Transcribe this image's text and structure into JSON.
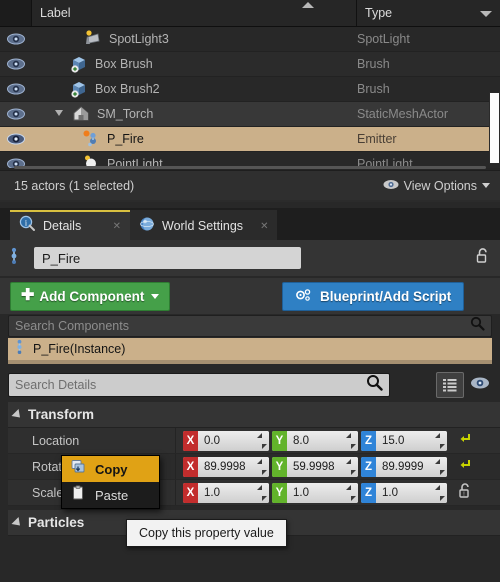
{
  "outliner": {
    "columns": {
      "gutter": "",
      "label": "Label",
      "type": "Type"
    },
    "rows": [
      {
        "name": "SpotLight3",
        "type": "SpotLight",
        "icon": "spotlight-icon",
        "indent": 1,
        "expandable": false,
        "selected": false
      },
      {
        "name": "Box Brush",
        "type": "Brush",
        "icon": "brush-icon",
        "indent": 0,
        "expandable": false,
        "selected": false
      },
      {
        "name": "Box Brush2",
        "type": "Brush",
        "icon": "brush-icon",
        "indent": 0,
        "expandable": false,
        "selected": false
      },
      {
        "name": "SM_Torch",
        "type": "StaticMeshActor",
        "icon": "static-mesh-icon",
        "indent": 0,
        "expandable": true,
        "selected": false
      },
      {
        "name": "P_Fire",
        "type": "Emitter",
        "icon": "emitter-icon",
        "indent": 1,
        "expandable": false,
        "selected": true
      },
      {
        "name": "PointLight",
        "type": "PointLight",
        "icon": "pointlight-icon",
        "indent": 1,
        "expandable": false,
        "selected": false
      }
    ],
    "footer": {
      "count": "15 actors (1 selected)",
      "view_options": "View Options"
    }
  },
  "details": {
    "tabs": [
      {
        "label": "Details",
        "icon": "details-info-icon",
        "active": true
      },
      {
        "label": "World Settings",
        "icon": "globe-icon",
        "active": false
      }
    ],
    "actor_name": {
      "value": "P_Fire",
      "placeholder": "Name"
    },
    "add_component_button": "Add Component",
    "blueprint_button": "Blueprint/Add Script",
    "search_components": {
      "value": "",
      "placeholder": "Search Components"
    },
    "component_list": [
      {
        "label": "P_Fire(Instance)",
        "selected": true
      }
    ],
    "search_details": {
      "value": "",
      "placeholder": "Search Details"
    },
    "categories": [
      {
        "name": "Transform",
        "expanded": true,
        "properties": [
          {
            "label": "Location",
            "x": "0.0",
            "y": "8.0",
            "z": "15.0",
            "has_reset": true
          },
          {
            "label": "Rotation",
            "x": "89.9998",
            "y": "59.9998",
            "z": "89.9999",
            "has_reset": true
          },
          {
            "label": "Scale",
            "x": "1.0",
            "y": "1.0",
            "z": "1.0",
            "has_reset": false,
            "has_lock": true,
            "has_dropdown": true
          }
        ]
      },
      {
        "name": "Particles",
        "expanded": true,
        "properties": []
      }
    ]
  },
  "context_menu": {
    "items": [
      {
        "label": "Copy",
        "icon": "copy-icon",
        "highlighted": true
      },
      {
        "label": "Paste",
        "icon": "paste-icon",
        "highlighted": false
      }
    ]
  },
  "tooltip": {
    "text": "Copy this property value"
  },
  "colors": {
    "selection_tan": "#cbb08a",
    "accent_yellow": "#d8c040",
    "add_component_green": "#45a049",
    "blueprint_blue": "#2f80c4",
    "menu_highlight_orange": "#e0a215",
    "axis_x_red": "#c22d2d",
    "axis_y_green": "#62b32b",
    "axis_z_blue": "#2f84d8",
    "reset_arrow": "#c8d400"
  }
}
